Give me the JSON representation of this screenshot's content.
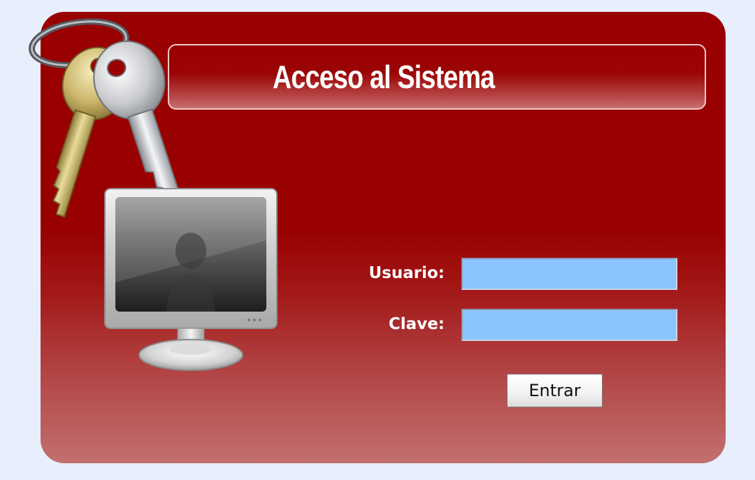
{
  "window": {
    "title": "Acceso al Sistema"
  },
  "form": {
    "user_label": "Usuario:",
    "user_value": "",
    "pass_label": "Clave:",
    "pass_value": "",
    "submit_label": "Entrar"
  },
  "icons": {
    "keys": "keys-icon",
    "monitor": "monitor-icon"
  },
  "colors": {
    "panel": "#990000",
    "field_bg": "#8cc4ff",
    "page_bg": "#e8eefc"
  }
}
